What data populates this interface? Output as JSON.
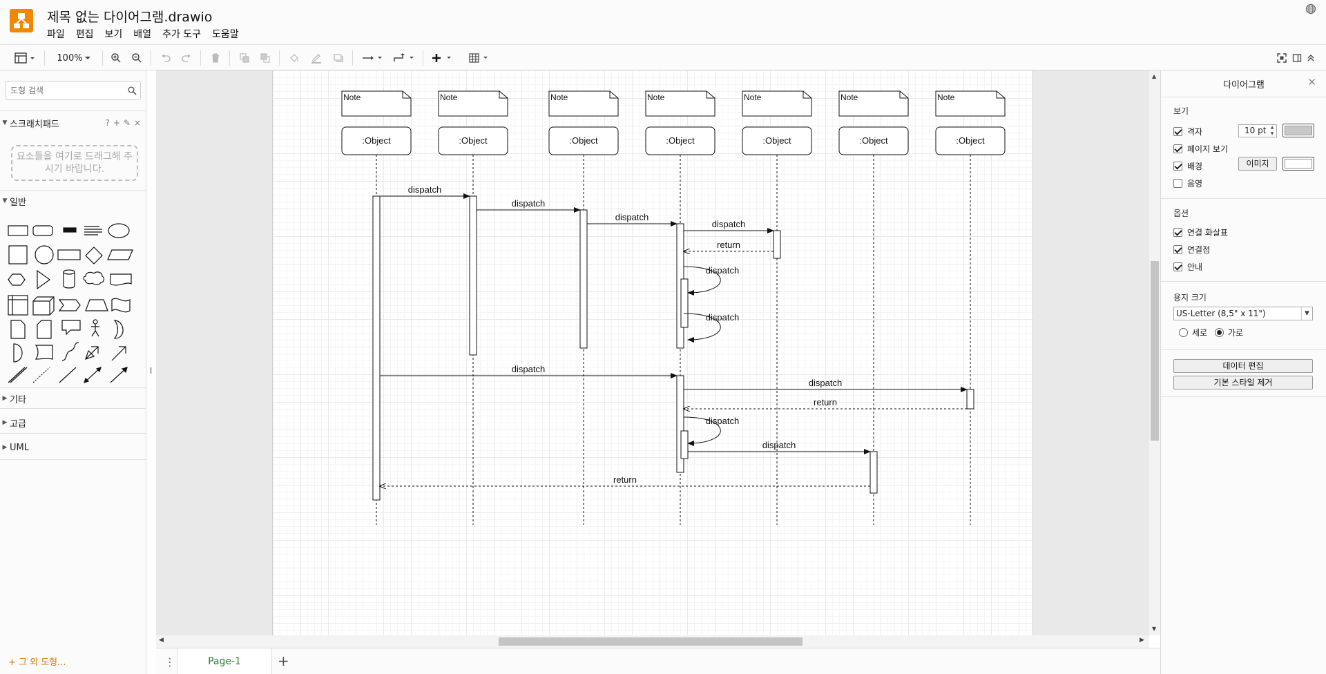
{
  "app": {
    "title": "제목 없는 다이어그램.drawio",
    "menu": [
      "파일",
      "편집",
      "보기",
      "배열",
      "추가 도구",
      "도움말"
    ]
  },
  "toolbar": {
    "zoom": "100%"
  },
  "sidebar": {
    "search_placeholder": "도형 검색",
    "scratchpad": {
      "title": "스크래치패드",
      "actions": [
        "?",
        "+",
        "✎",
        "×"
      ],
      "hint": "요소들을 여기로 드래그해 주시기 바랍니다."
    },
    "general_title": "일반",
    "sections": [
      "기타",
      "고급",
      "UML"
    ],
    "more_shapes": "+ 그 외 도형..."
  },
  "diagram": {
    "note_label": "Note",
    "object_label": ":Object",
    "messages": [
      "dispatch",
      "dispatch",
      "dispatch",
      "dispatch",
      "return",
      "dispatch",
      "dispatch",
      "dispatch",
      "dispatch",
      "return",
      "dispatch",
      "dispatch",
      "return"
    ]
  },
  "tabs": {
    "page": "Page-1"
  },
  "format_panel": {
    "title": "다이어그램",
    "view_section": "보기",
    "grid": "격자",
    "grid_size": "10 pt",
    "page_view": "페이지 보기",
    "background": "배경",
    "image_button": "이미지",
    "shadow": "음영",
    "options_section": "옵션",
    "connection_arrows": "연결 화살표",
    "connection_points": "연결점",
    "guides": "안내",
    "paper_section": "용지 크기",
    "paper_size": "US-Letter (8,5\" x 11\")",
    "portrait": "세로",
    "landscape": "가로",
    "edit_data": "데이터 편집",
    "clear_style": "기본 스타일 제거"
  },
  "colors": {
    "logo": "#f08705",
    "page_tab_text": "#2a7d33",
    "more_shapes": "#e07300"
  }
}
